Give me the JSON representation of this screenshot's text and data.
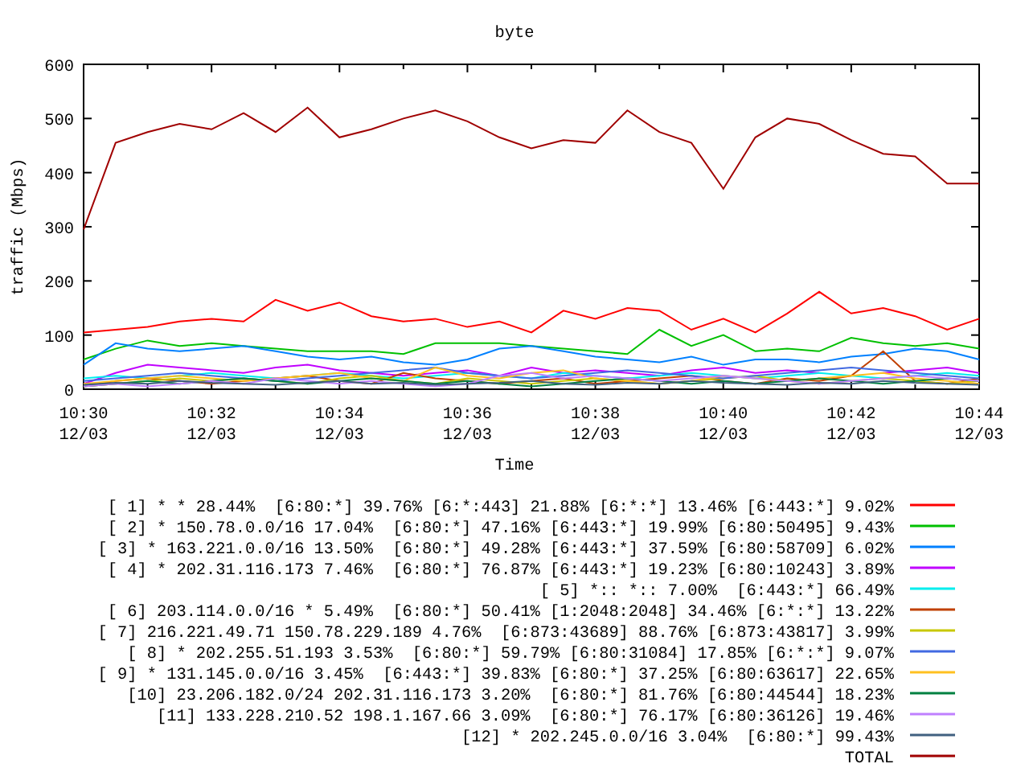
{
  "chart_data": {
    "type": "line",
    "title": "byte",
    "xlabel": "Time",
    "ylabel": "traffic (Mbps)",
    "categories": [
      "10:30 12/03",
      null,
      null,
      null,
      "10:32 12/03",
      null,
      null,
      null,
      "10:34 12/03",
      null,
      null,
      null,
      "10:36 12/03",
      null,
      null,
      null,
      "10:38 12/03",
      null,
      null,
      null,
      "10:40 12/03",
      null,
      null,
      null,
      "10:42 12/03",
      null,
      null,
      null,
      "10:44 12/03"
    ],
    "ylim": [
      0,
      600
    ],
    "legend": "below",
    "yticks": [
      0,
      100,
      200,
      300,
      400,
      500,
      600
    ],
    "series": [
      {
        "name": "[ 1] * * 28.44%  [6:80:*] 39.76% [6:*:443] 21.88% [6:*:*] 13.46% [6:443:*] 9.02%",
        "color": "#ff0000",
        "values": [
          105,
          110,
          115,
          125,
          130,
          125,
          165,
          145,
          160,
          135,
          125,
          130,
          115,
          125,
          105,
          145,
          130,
          150,
          145,
          110,
          130,
          105,
          140,
          180,
          140,
          150,
          135,
          110,
          130
        ]
      },
      {
        "name": "[ 2] * 150.78.0.0/16 17.04%  [6:80:*] 47.16% [6:443:*] 19.99% [6:80:50495] 9.43%",
        "color": "#00c000",
        "values": [
          55,
          75,
          90,
          80,
          85,
          80,
          75,
          70,
          70,
          70,
          65,
          85,
          85,
          85,
          80,
          75,
          70,
          65,
          110,
          80,
          100,
          70,
          75,
          70,
          95,
          85,
          80,
          85,
          75
        ]
      },
      {
        "name": "[ 3] * 163.221.0.0/16 13.50%  [6:80:*] 49.28% [6:443:*] 37.59% [6:80:58709] 6.02%",
        "color": "#0080ff",
        "values": [
          45,
          85,
          75,
          70,
          75,
          80,
          70,
          60,
          55,
          60,
          50,
          45,
          55,
          75,
          80,
          70,
          60,
          55,
          50,
          60,
          45,
          55,
          55,
          50,
          60,
          65,
          75,
          70,
          55
        ]
      },
      {
        "name": "[ 4] * 202.31.116.173 7.46%  [6:80:*] 76.87% [6:443:*] 19.23% [6:80:10243] 3.89%",
        "color": "#c000ff",
        "values": [
          10,
          30,
          45,
          40,
          35,
          30,
          40,
          45,
          35,
          30,
          25,
          30,
          35,
          25,
          40,
          30,
          35,
          30,
          25,
          35,
          40,
          30,
          35,
          30,
          null,
          30,
          35,
          40,
          30
        ]
      },
      {
        "name": "[ 5] *:: *:: 7.00%  [6:443:*] 66.49%",
        "color": "#00eeee",
        "values": [
          20,
          25,
          20,
          25,
          30,
          25,
          20,
          25,
          30,
          25,
          20,
          25,
          30,
          25,
          20,
          30,
          25,
          20,
          25,
          30,
          25,
          20,
          25,
          30,
          25,
          20,
          25,
          30,
          25
        ]
      },
      {
        "name": "[ 6] 203.114.0.0/16 * 5.49%  [6:80:*] 50.41% [1:2048:2048] 34.46% [6:*:*] 13.22%",
        "color": "#c04000",
        "values": [
          5,
          15,
          20,
          15,
          10,
          15,
          20,
          25,
          15,
          10,
          30,
          20,
          15,
          10,
          15,
          20,
          10,
          15,
          20,
          25,
          15,
          10,
          20,
          15,
          25,
          70,
          15,
          10,
          20
        ]
      },
      {
        "name": "[ 7] 216.221.49.71 150.78.229.189 4.76%  [6:873:43689] 88.76% [6:873:43817] 3.99%",
        "color": "#c8c800",
        "values": [
          5,
          10,
          15,
          20,
          15,
          20,
          15,
          10,
          20,
          25,
          15,
          10,
          20,
          15,
          10,
          15,
          20,
          15,
          10,
          15,
          20,
          25,
          15,
          10,
          15,
          20,
          15,
          10,
          15
        ]
      },
      {
        "name": "[ 8] * 202.255.51.193 3.53%  [6:80:*] 59.79% [6:80:31084] 17.85% [6:*:*] 9.07%",
        "color": "#4169e1",
        "values": [
          15,
          20,
          25,
          30,
          25,
          20,
          15,
          20,
          25,
          30,
          35,
          40,
          30,
          25,
          20,
          25,
          30,
          35,
          30,
          25,
          20,
          25,
          30,
          35,
          40,
          35,
          30,
          25,
          20
        ]
      },
      {
        "name": "[ 9] * 131.145.0.0/16 3.45%  [6:443:*] 39.83% [6:80:*] 37.25% [6:80:63617] 22.65%",
        "color": "#ffc020",
        "values": [
          10,
          15,
          20,
          25,
          20,
          15,
          20,
          25,
          30,
          20,
          15,
          40,
          25,
          20,
          30,
          35,
          20,
          15,
          10,
          15,
          25,
          20,
          15,
          20,
          25,
          30,
          20,
          15,
          10
        ]
      },
      {
        "name": "[10] 23.206.182.0/24 202.31.116.173 3.20%  [6:80:*] 81.76% [6:80:44544] 18.23%",
        "color": "#008040",
        "values": [
          5,
          10,
          15,
          10,
          15,
          20,
          15,
          10,
          15,
          20,
          15,
          10,
          15,
          10,
          5,
          10,
          15,
          20,
          15,
          10,
          15,
          10,
          15,
          20,
          15,
          10,
          15,
          20,
          15
        ]
      },
      {
        "name": "[11] 133.228.210.52 198.1.167.66 3.09%  [6:80:*] 76.17% [6:80:36126] 19.46%",
        "color": "#c080ff",
        "values": [
          5,
          10,
          5,
          10,
          15,
          10,
          20,
          15,
          10,
          15,
          10,
          5,
          10,
          25,
          30,
          20,
          25,
          20,
          15,
          20,
          25,
          20,
          15,
          10,
          15,
          20,
          25,
          20,
          15
        ]
      },
      {
        "name": "[12] * 202.245.0.0/16 3.04%  [6:80:*] 99.43%",
        "color": "#406080",
        "values": [
          8,
          12,
          10,
          15,
          12,
          10,
          8,
          12,
          15,
          10,
          12,
          8,
          10,
          12,
          15,
          10,
          8,
          12,
          10,
          15,
          12,
          10,
          8,
          12,
          10,
          15,
          12,
          10,
          8
        ]
      },
      {
        "name": "TOTAL",
        "color": "#a00000",
        "values": [
          295,
          455,
          475,
          490,
          480,
          510,
          475,
          520,
          465,
          480,
          500,
          515,
          495,
          465,
          445,
          460,
          455,
          515,
          475,
          455,
          370,
          465,
          500,
          490,
          460,
          435,
          430,
          380,
          380
        ]
      }
    ]
  }
}
